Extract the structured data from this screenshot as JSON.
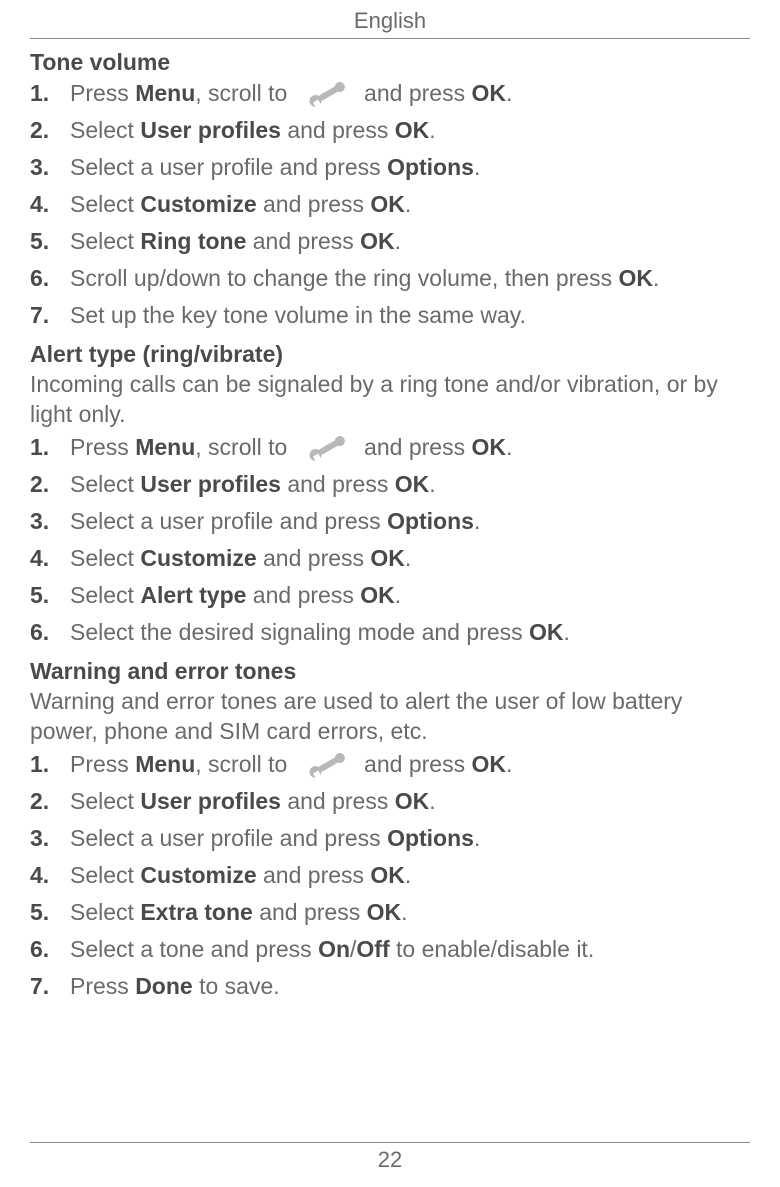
{
  "header": "English",
  "page_number": "22",
  "sections": [
    {
      "title": "Tone volume",
      "intro": "",
      "steps": [
        {
          "parts": [
            {
              "t": "Press "
            },
            {
              "t": "Menu",
              "b": true
            },
            {
              "t": ", scroll to "
            },
            {
              "icon": true
            },
            {
              "t": " and press "
            },
            {
              "t": "OK",
              "b": true
            },
            {
              "t": "."
            }
          ]
        },
        {
          "parts": [
            {
              "t": "Select "
            },
            {
              "t": "User profiles",
              "b": true
            },
            {
              "t": " and press "
            },
            {
              "t": "OK",
              "b": true
            },
            {
              "t": "."
            }
          ]
        },
        {
          "parts": [
            {
              "t": "Select a user profile and press "
            },
            {
              "t": "Options",
              "b": true
            },
            {
              "t": "."
            }
          ]
        },
        {
          "parts": [
            {
              "t": "Select "
            },
            {
              "t": "Customize",
              "b": true
            },
            {
              "t": " and press "
            },
            {
              "t": "OK",
              "b": true
            },
            {
              "t": "."
            }
          ]
        },
        {
          "parts": [
            {
              "t": "Select "
            },
            {
              "t": "Ring tone",
              "b": true
            },
            {
              "t": " and press "
            },
            {
              "t": "OK",
              "b": true
            },
            {
              "t": "."
            }
          ]
        },
        {
          "parts": [
            {
              "t": "Scroll up/down to change the ring volume, then press "
            },
            {
              "t": "OK",
              "b": true
            },
            {
              "t": "."
            }
          ]
        },
        {
          "parts": [
            {
              "t": "Set up the key tone volume in the same way."
            }
          ]
        }
      ]
    },
    {
      "title": "Alert type (ring/vibrate)",
      "intro": "Incoming calls can be signaled by a ring tone and/or vibration, or by light only.",
      "steps": [
        {
          "parts": [
            {
              "t": "Press "
            },
            {
              "t": "Menu",
              "b": true
            },
            {
              "t": ", scroll to "
            },
            {
              "icon": true
            },
            {
              "t": " and press "
            },
            {
              "t": "OK",
              "b": true
            },
            {
              "t": "."
            }
          ]
        },
        {
          "parts": [
            {
              "t": "Select "
            },
            {
              "t": "User profiles",
              "b": true
            },
            {
              "t": " and press "
            },
            {
              "t": "OK",
              "b": true
            },
            {
              "t": "."
            }
          ]
        },
        {
          "parts": [
            {
              "t": "Select a user profile and press "
            },
            {
              "t": "Options",
              "b": true
            },
            {
              "t": "."
            }
          ]
        },
        {
          "parts": [
            {
              "t": "Select "
            },
            {
              "t": "Customize",
              "b": true
            },
            {
              "t": " and press "
            },
            {
              "t": "OK",
              "b": true
            },
            {
              "t": "."
            }
          ]
        },
        {
          "parts": [
            {
              "t": "Select "
            },
            {
              "t": "Alert type",
              "b": true
            },
            {
              "t": " and press "
            },
            {
              "t": "OK",
              "b": true
            },
            {
              "t": "."
            }
          ]
        },
        {
          "parts": [
            {
              "t": "Select the desired signaling mode and press "
            },
            {
              "t": "OK",
              "b": true
            },
            {
              "t": "."
            }
          ]
        }
      ]
    },
    {
      "title": "Warning and error tones",
      "intro": "Warning and error tones are used to alert the user of low battery power, phone and SIM card errors, etc.",
      "steps": [
        {
          "parts": [
            {
              "t": "Press "
            },
            {
              "t": "Menu",
              "b": true
            },
            {
              "t": ", scroll to "
            },
            {
              "icon": true
            },
            {
              "t": " and press "
            },
            {
              "t": "OK",
              "b": true
            },
            {
              "t": "."
            }
          ]
        },
        {
          "parts": [
            {
              "t": "Select "
            },
            {
              "t": "User profiles",
              "b": true
            },
            {
              "t": " and press "
            },
            {
              "t": "OK",
              "b": true
            },
            {
              "t": "."
            }
          ]
        },
        {
          "parts": [
            {
              "t": "Select a user profile and press "
            },
            {
              "t": "Options",
              "b": true
            },
            {
              "t": "."
            }
          ]
        },
        {
          "parts": [
            {
              "t": "Select "
            },
            {
              "t": "Customize",
              "b": true
            },
            {
              "t": " and press "
            },
            {
              "t": "OK",
              "b": true
            },
            {
              "t": "."
            }
          ]
        },
        {
          "parts": [
            {
              "t": "Select "
            },
            {
              "t": "Extra tone",
              "b": true
            },
            {
              "t": " and press "
            },
            {
              "t": "OK",
              "b": true
            },
            {
              "t": "."
            }
          ]
        },
        {
          "parts": [
            {
              "t": "Select a tone and press "
            },
            {
              "t": "On",
              "b": true
            },
            {
              "t": "/"
            },
            {
              "t": "Off",
              "b": true
            },
            {
              "t": " to enable/disable it."
            }
          ]
        },
        {
          "parts": [
            {
              "t": "Press "
            },
            {
              "t": "Done",
              "b": true
            },
            {
              "t": " to save."
            }
          ]
        }
      ]
    }
  ]
}
